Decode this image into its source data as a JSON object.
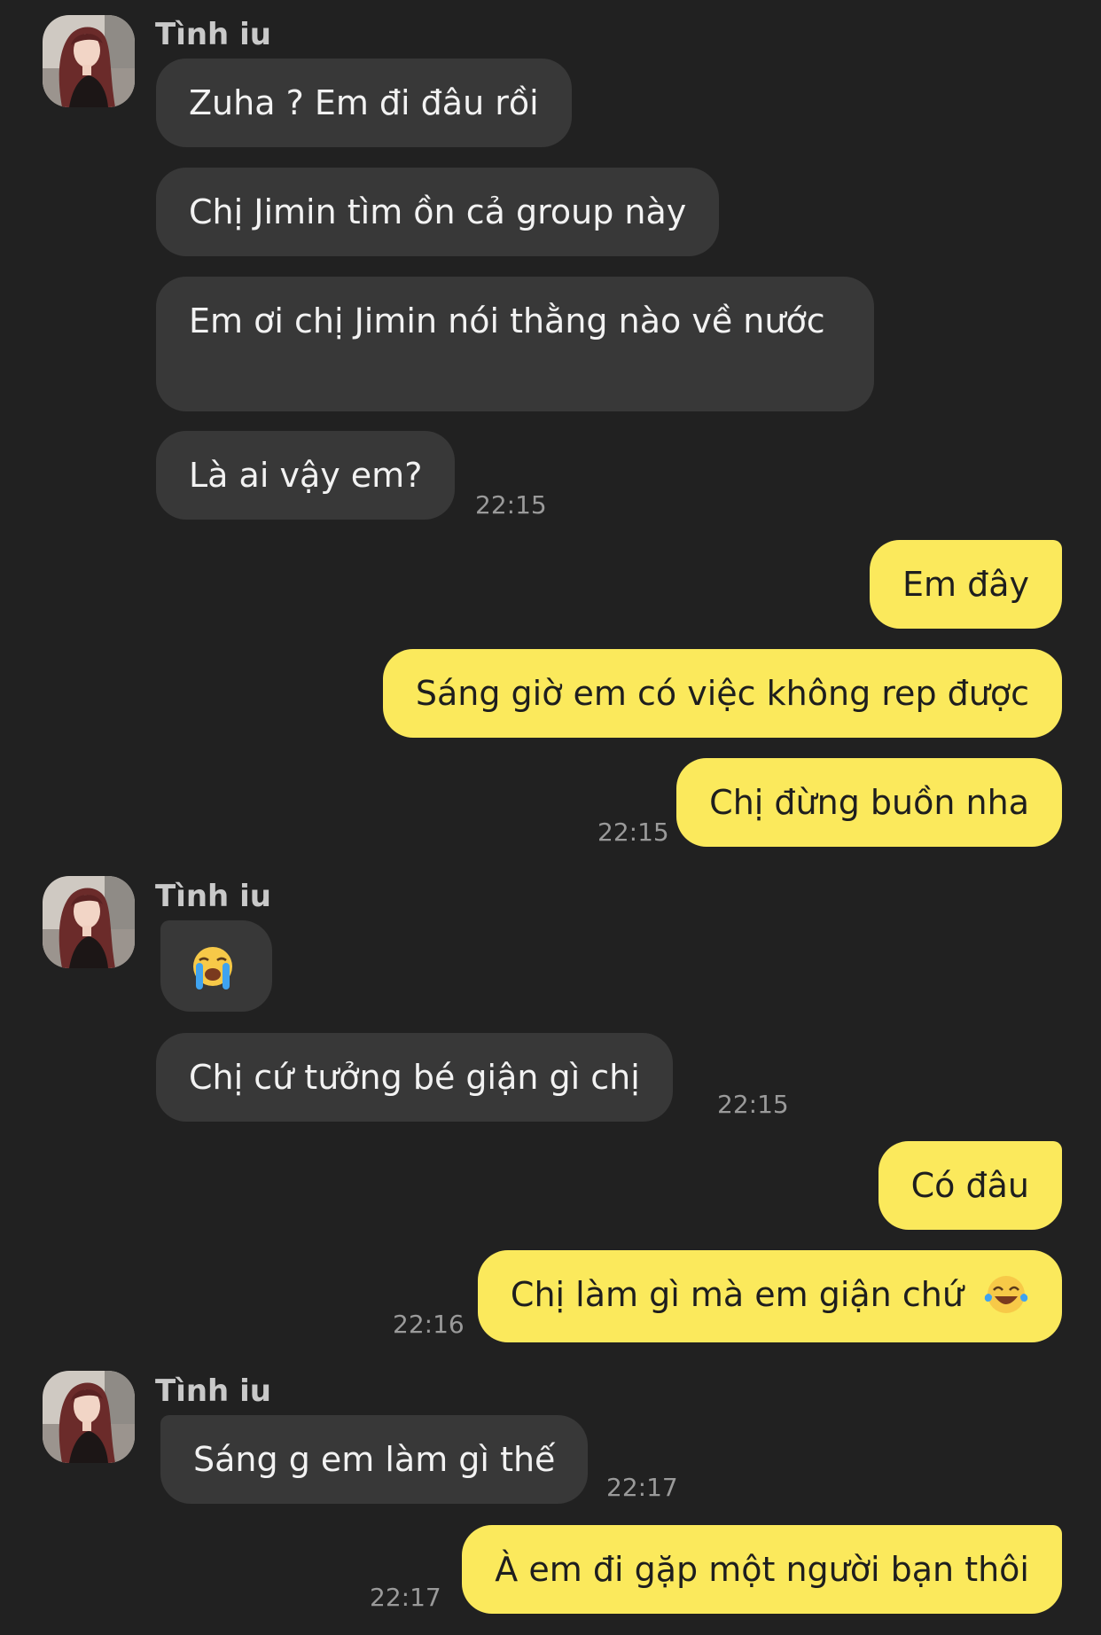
{
  "sender_name": "Tình iu",
  "messages": [
    {
      "text": "Zuha ? Em đi đâu rồi"
    },
    {
      "text": "Chị Jimin tìm ồn cả group này"
    },
    {
      "text": "Em ơi chị Jimin nói thằng nào về nước"
    },
    {
      "text": "Là ai vậy em?",
      "time": "22:15"
    },
    {
      "text": "Em đây"
    },
    {
      "text": "Sáng giờ em có việc không rep được"
    },
    {
      "text": "Chị đừng buồn nha",
      "time": "22:15"
    },
    {
      "icon": "loudly-crying-face-emoji"
    },
    {
      "text": "Chị cứ tưởng bé giận gì chị",
      "time": "22:15"
    },
    {
      "text": "Có đâu"
    },
    {
      "text": "Chị làm gì mà em giận chứ",
      "icon": "tears-of-joy-emoji",
      "time": "22:16"
    },
    {
      "text": "Sáng g em làm gì thế",
      "time": "22:17"
    },
    {
      "text": "À em đi gặp một người bạn thôi",
      "time": "22:17"
    }
  ],
  "colors": {
    "background": "#212121",
    "incoming_bubble": "#383838",
    "outgoing_bubble": "#fbe95c",
    "timestamp": "#9a9a9a"
  }
}
